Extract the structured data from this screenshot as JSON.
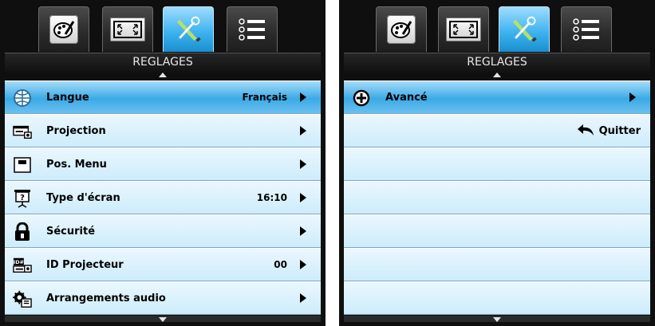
{
  "left": {
    "header": "REGLAGES",
    "items": [
      {
        "label": "Langue",
        "value": "Français",
        "icon": "globe-icon"
      },
      {
        "label": "Projection",
        "value": "",
        "icon": "projector-icon"
      },
      {
        "label": "Pos. Menu",
        "value": "",
        "icon": "menu-position-icon"
      },
      {
        "label": "Type d'écran",
        "value": "16:10",
        "icon": "screen-type-icon"
      },
      {
        "label": "Sécurité",
        "value": "",
        "icon": "lock-icon"
      },
      {
        "label": "ID Projecteur",
        "value": "00",
        "icon": "projector-id-icon"
      },
      {
        "label": "Arrangements audio",
        "value": "",
        "icon": "audio-settings-icon"
      }
    ]
  },
  "right": {
    "header": "REGLAGES",
    "items": [
      {
        "label": "Avancé",
        "icon": "plus-circle-icon"
      }
    ],
    "quit_label": "Quitter"
  },
  "tabs": [
    "image-palette-icon",
    "display-fullscreen-icon",
    "settings-tools-icon",
    "options-list-icon"
  ],
  "colors": {
    "selected_row": "#3aa9e6",
    "row": "#daf1fc",
    "frame": "#0f0f0f"
  }
}
